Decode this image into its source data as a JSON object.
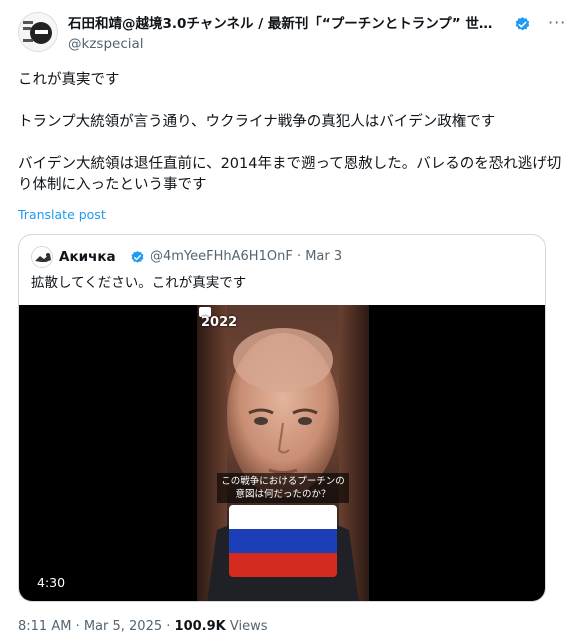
{
  "author": {
    "name": "石田和靖@越境3.0チャンネル / 最新刊「“プーチンとトランプ” 世…",
    "handle": "@kzspecial",
    "avatar_icon": "author-avatar-icon",
    "verified_icon": "verified-badge-icon",
    "more_icon": "more-options-icon"
  },
  "post": {
    "paragraphs": [
      "これが真実です",
      "トランプ大統領が言う通り、ウクライナ戦争の真犯人はバイデン政権です",
      "バイデン大統領は退任直前に、2014年まで遡って恩赦した。バレるのを恐れ逃げ切り体制に入ったという事です"
    ],
    "translate_label": "Translate post",
    "timestamp": "8:11 AM · Mar 5, 2025",
    "separator": "·",
    "views_count": "100.9K",
    "views_label": "Views"
  },
  "quoted": {
    "name": "Акичка",
    "handle": "@4mYeeFHhA6H1OnF",
    "date": "· Mar 3",
    "text": "拡散してください。これが真実です",
    "video": {
      "year_label": "2022",
      "subtitle_line1": "この戦争におけるプーチンの",
      "subtitle_line2": "意図は何だったのか？",
      "duration": "4:30",
      "flag_colors": [
        "#ffffff",
        "#1c3fb8",
        "#d52b1e"
      ]
    }
  },
  "colors": {
    "link": "#1d9bf0",
    "verified": "#1d9bf0",
    "secondary_text": "#536471"
  }
}
